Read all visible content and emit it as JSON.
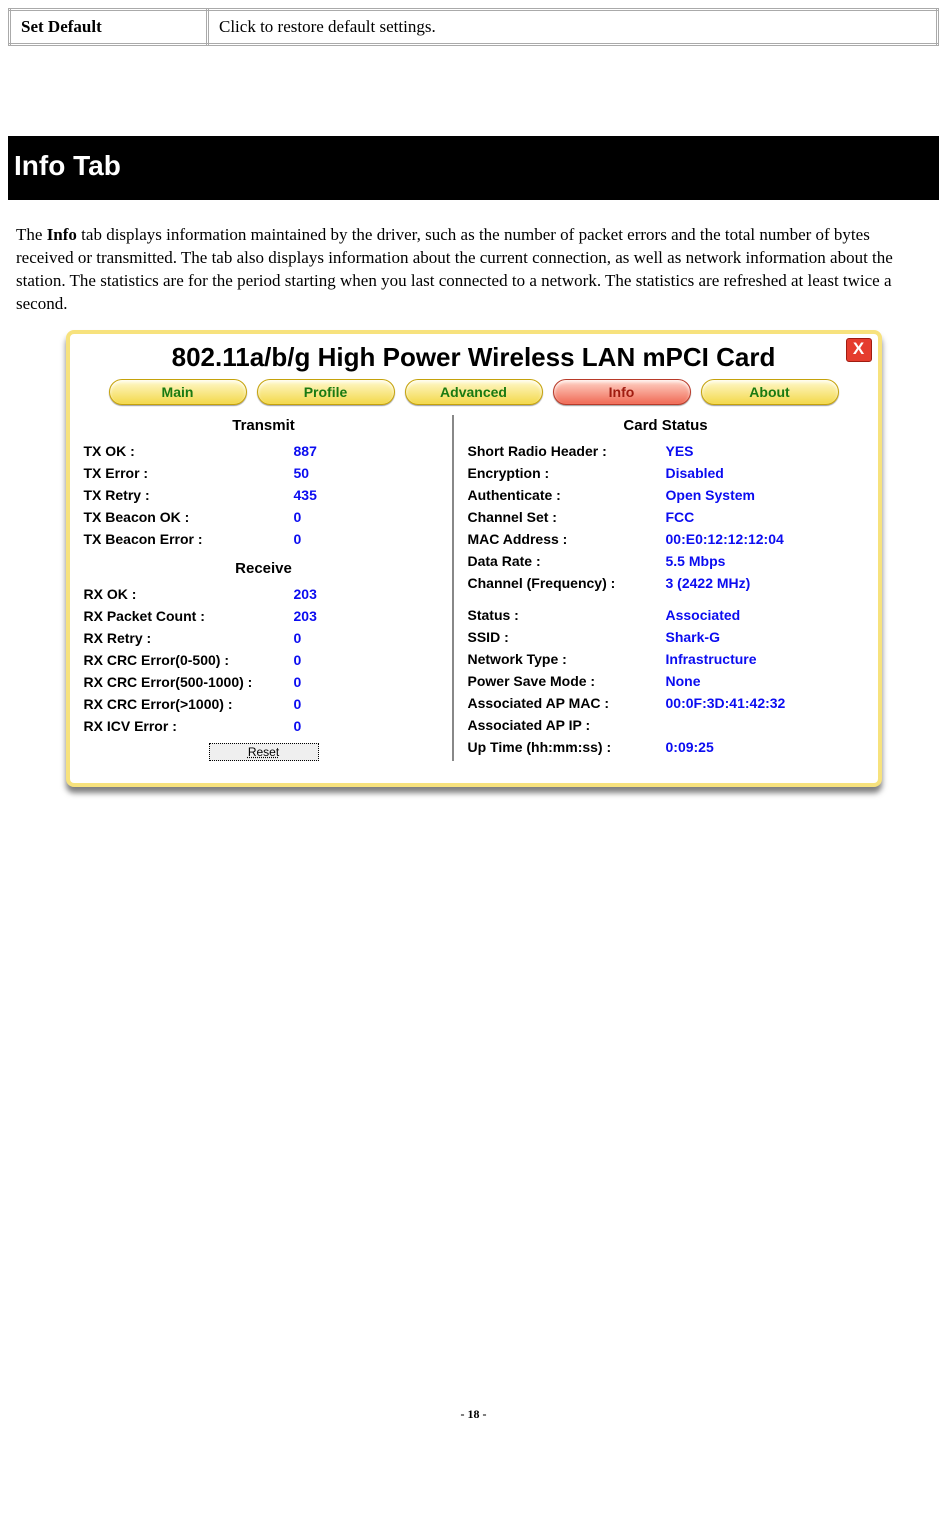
{
  "param_table": {
    "label": "Set Default",
    "desc": "Click to restore default settings."
  },
  "section_title": "Info Tab",
  "intro_bold": "Info",
  "intro_before": "The ",
  "intro_after": " tab displays information maintained by the driver, such as the number of packet errors and the total number of bytes received or transmitted. The tab also displays information about the current connection, as well as network information about the station. The statistics are for the period starting when you last connected to a network. The statistics are refreshed at least twice a second.",
  "app": {
    "title": "802.11a/b/g High Power Wireless LAN mPCI Card",
    "close": "X",
    "tabs": {
      "main": "Main",
      "profile": "Profile",
      "advanced": "Advanced",
      "info": "Info",
      "about": "About"
    },
    "left": {
      "transmit_head": "Transmit",
      "receive_head": "Receive",
      "tx_ok_k": "TX OK :",
      "tx_ok_v": "887",
      "tx_err_k": "TX Error :",
      "tx_err_v": "50",
      "tx_retry_k": "TX Retry :",
      "tx_retry_v": "435",
      "tx_bok_k": "TX Beacon OK :",
      "tx_bok_v": "0",
      "tx_berr_k": "TX Beacon Error :",
      "tx_berr_v": "0",
      "rx_ok_k": "RX OK :",
      "rx_ok_v": "203",
      "rx_pkt_k": "RX Packet Count :",
      "rx_pkt_v": "203",
      "rx_retry_k": "RX Retry :",
      "rx_retry_v": "0",
      "rx_crc0_k": "RX CRC Error(0-500) :",
      "rx_crc0_v": "0",
      "rx_crc5_k": "RX CRC Error(500-1000) :",
      "rx_crc5_v": "0",
      "rx_crc1_k": "RX CRC Error(>1000) :",
      "rx_crc1_v": "0",
      "rx_icv_k": "RX ICV Error :",
      "rx_icv_v": "0",
      "reset": "Reset"
    },
    "right": {
      "card_head": "Card Status",
      "srh_k": "Short Radio Header :",
      "srh_v": "YES",
      "enc_k": "Encryption :",
      "enc_v": "Disabled",
      "auth_k": "Authenticate :",
      "auth_v": "Open System",
      "chset_k": "Channel Set :",
      "chset_v": "FCC",
      "mac_k": "MAC Address :",
      "mac_v": "00:E0:12:12:12:04",
      "rate_k": "Data Rate :",
      "rate_v": "5.5 Mbps",
      "chfreq_k": "Channel (Frequency) :",
      "chfreq_v": "3 (2422 MHz)",
      "status_k": "Status :",
      "status_v": "Associated",
      "ssid_k": "SSID :",
      "ssid_v": "Shark-G",
      "nettype_k": "Network Type :",
      "nettype_v": "Infrastructure",
      "psm_k": "Power Save Mode :",
      "psm_v": "None",
      "apmac_k": "Associated AP MAC :",
      "apmac_v": "00:0F:3D:41:42:32",
      "apip_k": "Associated AP IP :",
      "apip_v": "",
      "uptime_k": "Up Time (hh:mm:ss) :",
      "uptime_v": "0:09:25"
    }
  },
  "page_number": "- 18 -"
}
